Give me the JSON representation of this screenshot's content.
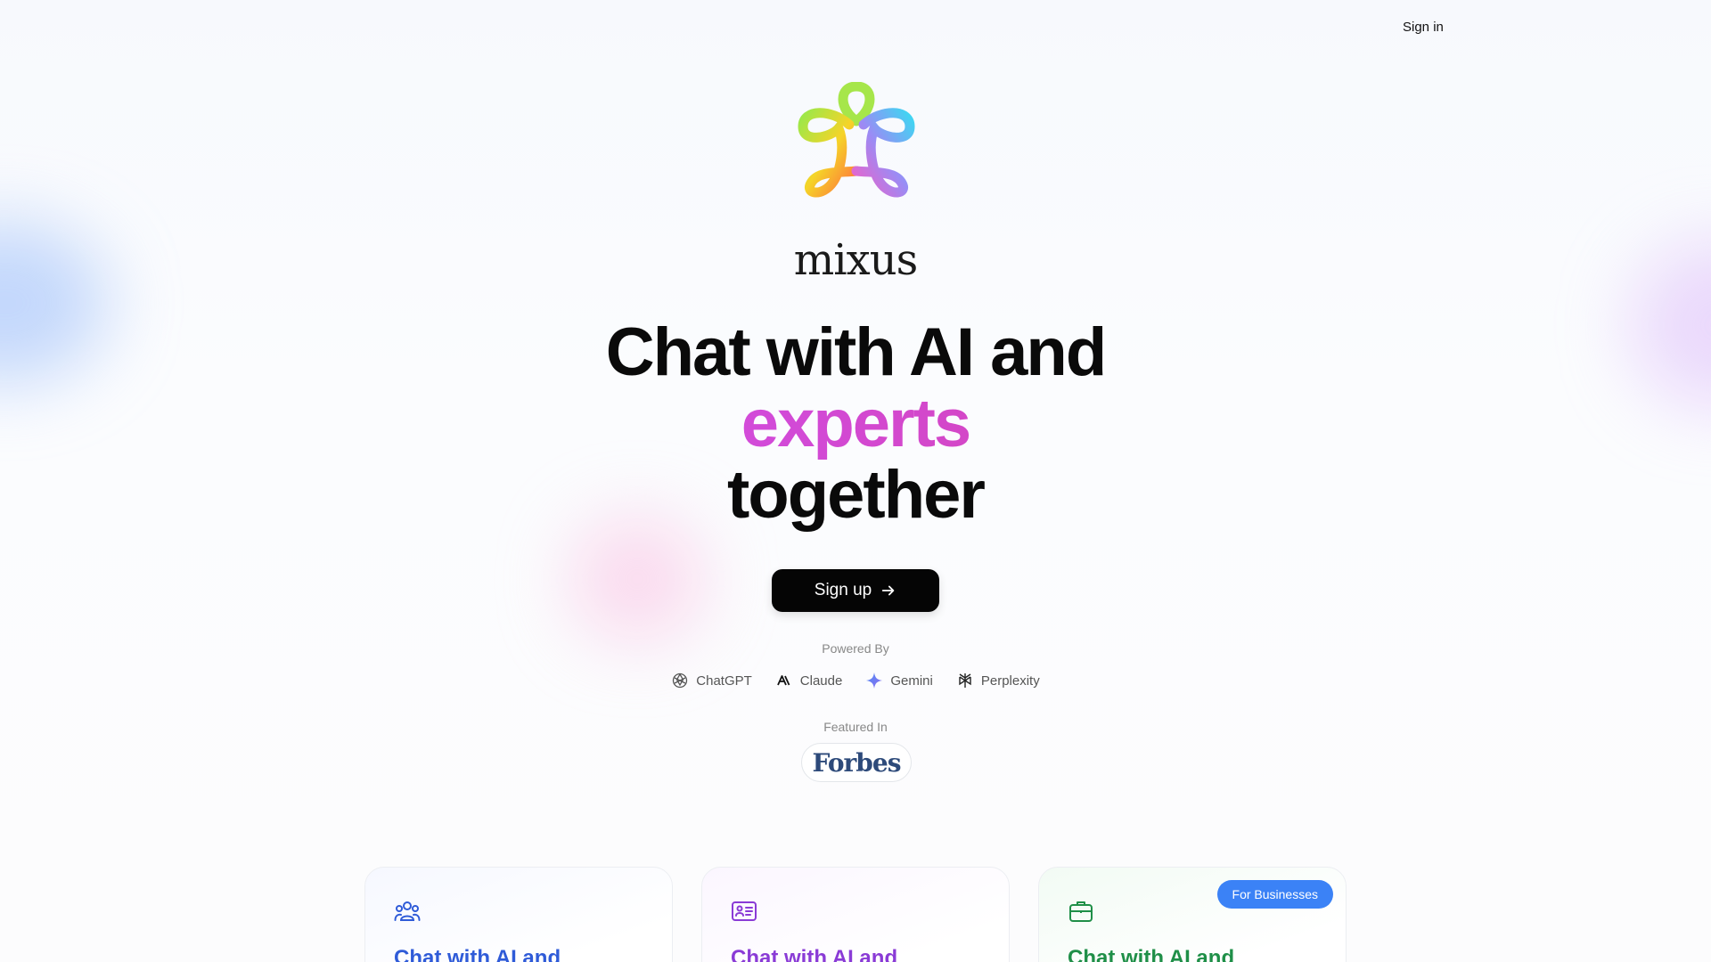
{
  "nav": {
    "signin_label": "Sign in"
  },
  "brand": {
    "wordmark": "mixus"
  },
  "hero": {
    "headline_line1": "Chat with AI and",
    "headline_line2": "experts",
    "headline_line3": "together",
    "signup_label": "Sign up"
  },
  "powered_by": {
    "label": "Powered By",
    "providers": [
      {
        "name": "ChatGPT",
        "icon": "openai-icon"
      },
      {
        "name": "Claude",
        "icon": "anthropic-icon"
      },
      {
        "name": "Gemini",
        "icon": "gemini-icon"
      },
      {
        "name": "Perplexity",
        "icon": "perplexity-icon"
      }
    ]
  },
  "featured_in": {
    "label": "Featured In",
    "outlet": "Forbes"
  },
  "cards": [
    {
      "title": "Chat with AI and",
      "icon": "users-icon",
      "color": "#2f5bd8"
    },
    {
      "title": "Chat with AI and",
      "icon": "id-card-icon",
      "color": "#8a3bd6"
    },
    {
      "title": "Chat with AI and",
      "icon": "briefcase-icon",
      "color": "#1f8f48",
      "badge": "For Businesses"
    }
  ],
  "colors": {
    "primary_button": "#050505",
    "accent_gradient_start": "#e873f0",
    "accent_gradient_end": "#d93b8a",
    "badge": "#3b82f6"
  }
}
